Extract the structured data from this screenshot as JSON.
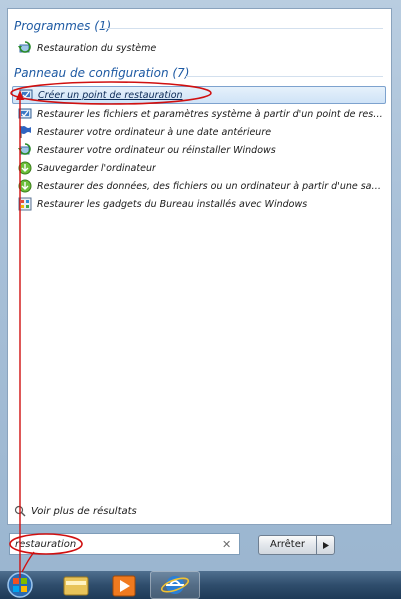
{
  "groups": {
    "programs_header": "Programmes (1)",
    "control_panel_header": "Panneau de configuration (7)"
  },
  "programs": [
    {
      "label": "Restauration du système",
      "icon": "system-restore-icon"
    }
  ],
  "control_panel": [
    {
      "label": "Créer un point de restauration",
      "icon": "restore-point-icon",
      "selected": true
    },
    {
      "label": "Restaurer les fichiers et paramètres système à partir d'un point de restaurat...",
      "icon": "restore-point-icon"
    },
    {
      "label": "Restaurer votre ordinateur à une date antérieure",
      "icon": "flag-icon"
    },
    {
      "label": "Restaurer votre ordinateur ou réinstaller Windows",
      "icon": "system-restore-icon"
    },
    {
      "label": "Sauvegarder l'ordinateur",
      "icon": "backup-icon"
    },
    {
      "label": "Restaurer des données, des fichiers ou un ordinateur à partir d'une sauvega...",
      "icon": "backup-icon"
    },
    {
      "label": "Restaurer les gadgets du Bureau installés avec Windows",
      "icon": "gadgets-icon"
    }
  ],
  "see_more": "Voir plus de résultats",
  "search": {
    "value": "restauration"
  },
  "shutdown": {
    "label": "Arrêter"
  },
  "taskbar": {
    "items": [
      "start-orb-icon",
      "explorer-icon",
      "media-player-icon",
      "internet-explorer-icon"
    ]
  },
  "colors": {
    "header": "#1e5aa3",
    "annotation": "#d01010"
  }
}
